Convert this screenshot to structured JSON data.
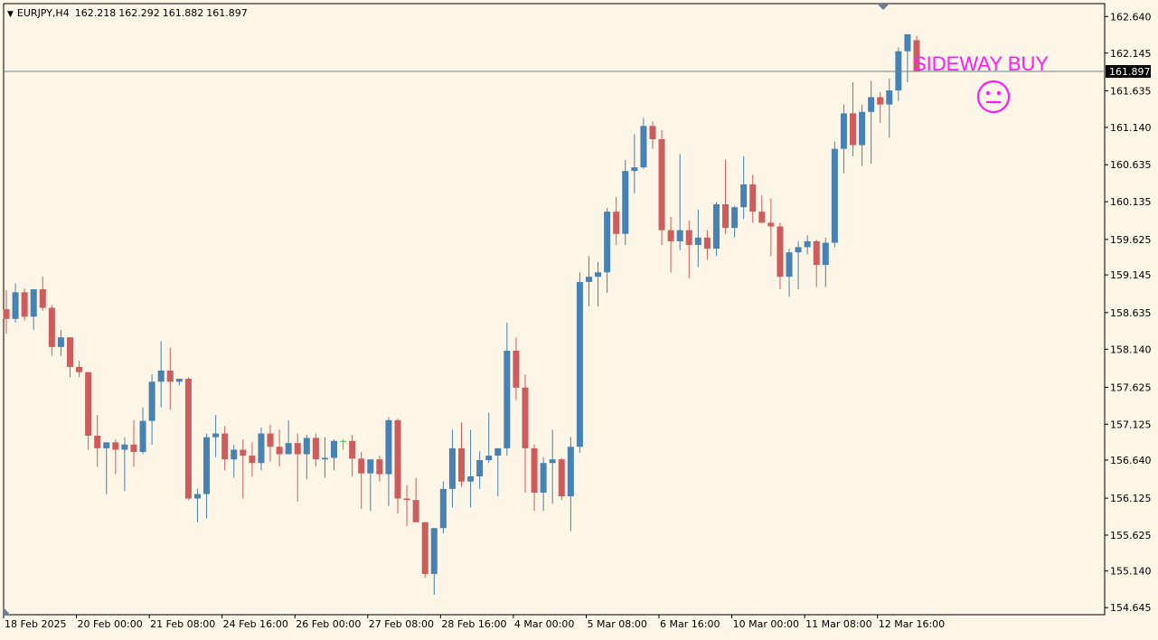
{
  "header": {
    "symbol": "EURJPY,H4",
    "ohlc": [
      "162.218",
      "162.292",
      "161.882",
      "161.897"
    ]
  },
  "signal": {
    "text": "SIDEWAY BUY",
    "icon": "neutral-face-icon",
    "color": "#ff19ff"
  },
  "current_price": "161.897",
  "colors": {
    "background": "#fdf5e6",
    "bull": "#4682b4",
    "bear": "#cd5c5c",
    "doji": "#32cd32",
    "price_line": "#6e7f8f",
    "axis_text": "#000000",
    "price_tag_bg": "#000000"
  },
  "chart_data": {
    "type": "candlestick",
    "title": "EURJPY,H4",
    "ylim": [
      154.61,
      162.68
    ],
    "y_ticks": [
      "162.640",
      "162.145",
      "161.635",
      "161.140",
      "160.635",
      "160.135",
      "159.625",
      "159.145",
      "158.635",
      "158.140",
      "157.625",
      "157.125",
      "156.640",
      "156.125",
      "155.625",
      "155.140",
      "154.645"
    ],
    "x_ticks": [
      "18 Feb 2025",
      "20 Feb 00:00",
      "21 Feb 08:00",
      "24 Feb 16:00",
      "26 Feb 00:00",
      "27 Feb 08:00",
      "28 Feb 16:00",
      "4 Mar 00:00",
      "5 Mar 08:00",
      "6 Mar 16:00",
      "10 Mar 00:00",
      "11 Mar 08:00",
      "12 Mar 16:00"
    ],
    "candles": [
      [
        158.68,
        158.94,
        158.35,
        158.55
      ],
      [
        158.55,
        159.03,
        158.5,
        158.91
      ],
      [
        158.91,
        158.96,
        158.53,
        158.58
      ],
      [
        158.58,
        158.88,
        158.4,
        158.95
      ],
      [
        158.95,
        159.12,
        158.66,
        158.7
      ],
      [
        158.7,
        158.74,
        158.05,
        158.17
      ],
      [
        158.17,
        158.4,
        158.05,
        158.3
      ],
      [
        158.3,
        158.3,
        157.76,
        157.9
      ],
      [
        157.9,
        157.98,
        157.76,
        157.83
      ],
      [
        157.83,
        157.83,
        156.78,
        156.97
      ],
      [
        156.97,
        157.25,
        156.55,
        156.8
      ],
      [
        156.8,
        156.85,
        156.18,
        156.88
      ],
      [
        156.88,
        156.92,
        156.45,
        156.78
      ],
      [
        156.78,
        156.95,
        156.22,
        156.85
      ],
      [
        156.85,
        157.18,
        156.55,
        156.75
      ],
      [
        156.75,
        157.35,
        156.72,
        157.17
      ],
      [
        157.17,
        157.8,
        156.85,
        157.7
      ],
      [
        157.7,
        158.25,
        157.35,
        157.85
      ],
      [
        157.85,
        158.16,
        157.32,
        157.7
      ],
      [
        157.7,
        157.74,
        157.65,
        157.74
      ],
      [
        157.74,
        157.76,
        156.1,
        156.12
      ],
      [
        156.12,
        156.25,
        155.8,
        156.18
      ],
      [
        156.18,
        157.0,
        155.85,
        156.95
      ],
      [
        156.95,
        157.25,
        156.68,
        157.0
      ],
      [
        157.0,
        157.1,
        156.5,
        156.65
      ],
      [
        156.65,
        156.85,
        156.4,
        156.78
      ],
      [
        156.78,
        156.92,
        156.12,
        156.7
      ],
      [
        156.7,
        156.88,
        156.42,
        156.6
      ],
      [
        156.6,
        157.08,
        156.5,
        157.0
      ],
      [
        157.0,
        157.12,
        156.62,
        156.82
      ],
      [
        156.82,
        157.05,
        156.55,
        156.72
      ],
      [
        156.72,
        157.18,
        156.72,
        156.87
      ],
      [
        156.87,
        157.0,
        156.08,
        156.72
      ],
      [
        156.72,
        156.98,
        156.38,
        156.94
      ],
      [
        156.94,
        157.0,
        156.55,
        156.65
      ],
      [
        156.65,
        156.95,
        156.4,
        156.67
      ],
      [
        156.67,
        156.92,
        156.5,
        156.9
      ],
      [
        156.9,
        156.92,
        156.78,
        156.9
      ],
      [
        156.9,
        156.98,
        156.42,
        156.66
      ],
      [
        156.66,
        156.75,
        155.98,
        156.46
      ],
      [
        156.46,
        156.6,
        155.95,
        156.65
      ],
      [
        156.65,
        156.7,
        156.35,
        156.45
      ],
      [
        156.45,
        157.22,
        156.02,
        157.18
      ],
      [
        157.18,
        157.2,
        155.92,
        156.12
      ],
      [
        156.12,
        156.3,
        155.75,
        156.1
      ],
      [
        156.1,
        156.4,
        155.85,
        155.8
      ],
      [
        155.8,
        155.8,
        155.05,
        155.1
      ],
      [
        155.1,
        155.72,
        154.82,
        155.72
      ],
      [
        155.72,
        156.35,
        155.65,
        156.25
      ],
      [
        156.25,
        157.05,
        156.0,
        156.8
      ],
      [
        156.8,
        157.15,
        156.28,
        156.35
      ],
      [
        156.35,
        157.05,
        156.0,
        156.42
      ],
      [
        156.42,
        156.76,
        156.25,
        156.64
      ],
      [
        156.64,
        157.28,
        156.6,
        156.7
      ],
      [
        156.7,
        156.8,
        156.15,
        156.8
      ],
      [
        156.8,
        158.5,
        156.7,
        158.12
      ],
      [
        158.12,
        158.3,
        157.45,
        157.62
      ],
      [
        157.62,
        157.8,
        156.2,
        156.8
      ],
      [
        156.8,
        156.85,
        155.95,
        156.2
      ],
      [
        156.2,
        156.68,
        155.95,
        156.6
      ],
      [
        156.6,
        157.05,
        156.05,
        156.65
      ],
      [
        156.65,
        156.67,
        156.1,
        156.15
      ],
      [
        156.15,
        156.95,
        155.68,
        156.82
      ],
      [
        156.82,
        159.18,
        156.74,
        159.05
      ],
      [
        159.05,
        159.4,
        158.72,
        159.12
      ],
      [
        159.12,
        159.32,
        158.72,
        159.18
      ],
      [
        159.18,
        160.05,
        158.9,
        160.0
      ],
      [
        160.0,
        160.2,
        159.55,
        159.7
      ],
      [
        159.7,
        160.7,
        159.55,
        160.55
      ],
      [
        160.55,
        161.05,
        160.25,
        160.6
      ],
      [
        160.6,
        161.27,
        160.58,
        161.16
      ],
      [
        161.16,
        161.22,
        160.85,
        160.98
      ],
      [
        160.98,
        161.1,
        159.55,
        159.75
      ],
      [
        159.75,
        159.93,
        159.18,
        159.6
      ],
      [
        159.6,
        160.78,
        159.48,
        159.75
      ],
      [
        159.75,
        159.88,
        159.1,
        159.55
      ],
      [
        159.55,
        160.03,
        159.25,
        159.65
      ],
      [
        159.65,
        159.75,
        159.35,
        159.5
      ],
      [
        159.5,
        160.13,
        159.4,
        160.1
      ],
      [
        160.1,
        160.7,
        159.7,
        159.78
      ],
      [
        159.78,
        160.08,
        159.65,
        160.06
      ],
      [
        160.06,
        160.75,
        159.9,
        160.37
      ],
      [
        160.37,
        160.5,
        159.85,
        160.0
      ],
      [
        160.0,
        160.22,
        159.9,
        159.85
      ],
      [
        159.85,
        160.18,
        159.4,
        159.8
      ],
      [
        159.8,
        159.85,
        158.95,
        159.12
      ],
      [
        159.12,
        159.5,
        158.85,
        159.45
      ],
      [
        159.45,
        159.6,
        158.95,
        159.52
      ],
      [
        159.52,
        159.68,
        159.42,
        159.6
      ],
      [
        159.6,
        159.62,
        158.98,
        159.28
      ],
      [
        159.28,
        159.65,
        158.98,
        159.58
      ],
      [
        159.58,
        160.95,
        159.52,
        160.85
      ],
      [
        160.85,
        161.45,
        160.52,
        161.33
      ],
      [
        161.33,
        161.75,
        160.75,
        160.9
      ],
      [
        160.9,
        161.45,
        160.62,
        161.35
      ],
      [
        161.35,
        161.77,
        160.65,
        161.55
      ],
      [
        161.55,
        161.62,
        161.2,
        161.45
      ],
      [
        161.45,
        161.8,
        161.0,
        161.64
      ],
      [
        161.64,
        162.22,
        161.5,
        162.17
      ],
      [
        162.17,
        162.4,
        161.75,
        162.4
      ],
      [
        162.32,
        162.38,
        161.9,
        161.9
      ]
    ]
  }
}
